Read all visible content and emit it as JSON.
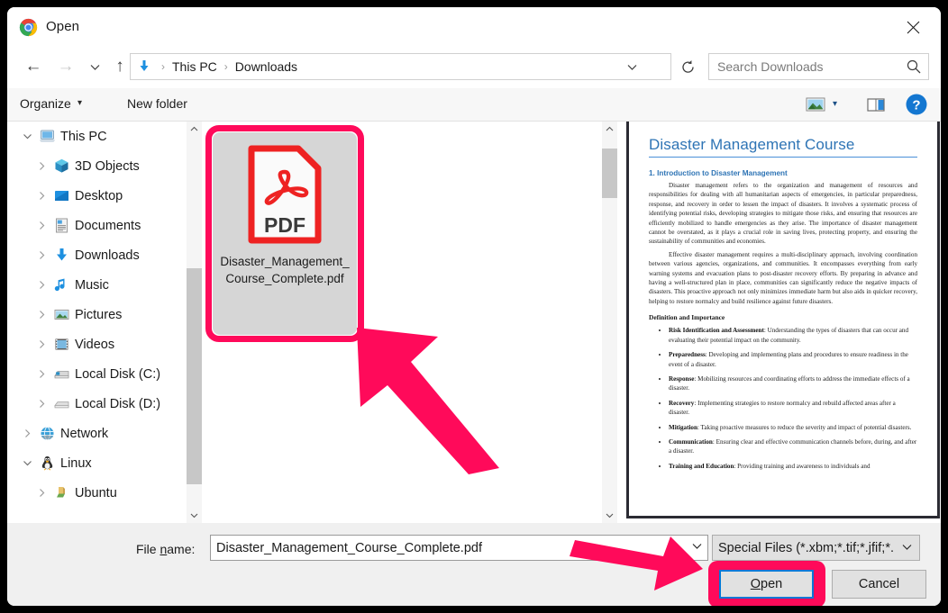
{
  "window": {
    "title": "Open",
    "app_icon": "chrome-logo-icon",
    "close_label": "×"
  },
  "nav": {
    "back_icon": "←",
    "forward_icon": "→",
    "recent_icon": "⌄",
    "up_icon": "↑",
    "address_icon": "downloads-arrow-icon",
    "breadcrumbs": [
      "This PC",
      "Downloads"
    ],
    "breadcrumb_separator": "›",
    "dropdown_icon": "⌄",
    "refresh_icon": "↻"
  },
  "search": {
    "placeholder": "Search Downloads",
    "icon": "search-icon"
  },
  "command_bar": {
    "organize_label": "Organize",
    "organize_caret": "▾",
    "new_folder_label": "New folder",
    "view_icon": "picture-view-icon",
    "view_caret": "▾",
    "pane_icon": "preview-pane-icon",
    "help_icon": "?"
  },
  "sidebar": {
    "items": [
      {
        "label": "This PC",
        "icon": "this-pc-icon",
        "depth": 0,
        "expander": "⌄",
        "expanded": true
      },
      {
        "label": "3D Objects",
        "icon": "3d-objects-icon",
        "depth": 1,
        "expander": "›",
        "expanded": false
      },
      {
        "label": "Desktop",
        "icon": "desktop-icon",
        "depth": 1,
        "expander": "›",
        "expanded": false
      },
      {
        "label": "Documents",
        "icon": "documents-icon",
        "depth": 1,
        "expander": "›",
        "expanded": false
      },
      {
        "label": "Downloads",
        "icon": "downloads-icon",
        "depth": 1,
        "expander": "›",
        "expanded": false
      },
      {
        "label": "Music",
        "icon": "music-icon",
        "depth": 1,
        "expander": "›",
        "expanded": false
      },
      {
        "label": "Pictures",
        "icon": "pictures-icon",
        "depth": 1,
        "expander": "›",
        "expanded": false
      },
      {
        "label": "Videos",
        "icon": "videos-icon",
        "depth": 1,
        "expander": "›",
        "expanded": false
      },
      {
        "label": "Local Disk (C:)",
        "icon": "hard-disk-icon",
        "depth": 1,
        "expander": "›",
        "expanded": false
      },
      {
        "label": "Local Disk (D:)",
        "icon": "hard-disk-icon",
        "depth": 1,
        "expander": "›",
        "expanded": false
      },
      {
        "label": "Network",
        "icon": "network-icon",
        "depth": 0,
        "expander": "›",
        "expanded": false
      },
      {
        "label": "Linux",
        "icon": "linux-penguin-icon",
        "depth": 0,
        "expander": "⌄",
        "expanded": true
      },
      {
        "label": "Ubuntu",
        "icon": "ubuntu-icon",
        "depth": 1,
        "expander": "›",
        "expanded": false
      }
    ],
    "scroll_up_icon": "⌃",
    "scroll_down_icon": "⌄"
  },
  "file_list": {
    "files": [
      {
        "name": "Disaster_Management_Course_Complete.pdf",
        "icon": "pdf-file-icon",
        "icon_label": "PDF",
        "selected": true
      }
    ],
    "scroll_up_icon": "⌃",
    "scroll_down_icon": "⌄"
  },
  "preview": {
    "doc_title": "Disaster Management Course",
    "heading_1": "1. Introduction to Disaster Management",
    "paragraph_1": "Disaster management refers to the organization and management of resources and responsibilities for dealing with all humanitarian aspects of emergencies, in particular preparedness, response, and recovery in order to lessen the impact of disasters. It involves a systematic process of identifying potential risks, developing strategies to mitigate those risks, and ensuring that resources are efficiently mobilized to handle emergencies as they arise. The importance of disaster management cannot be overstated, as it plays a crucial role in saving lives, protecting property, and ensuring the sustainability of communities and economies.",
    "paragraph_2": "Effective disaster management requires a multi-disciplinary approach, involving coordination between various agencies, organizations, and communities. It encompasses everything from early warning systems and evacuation plans to post-disaster recovery efforts. By preparing in advance and having a well-structured plan in place, communities can significantly reduce the negative impacts of disasters. This proactive approach not only minimizes immediate harm but also aids in quicker recovery, helping to restore normalcy and build resilience against future disasters.",
    "heading_2": "Definition and Importance",
    "bullets": [
      {
        "term": "Risk Identification and Assessment",
        "text": ": Understanding the types of disasters that can occur and evaluating their potential impact on the community."
      },
      {
        "term": "Preparedness",
        "text": ": Developing and implementing plans and procedures to ensure readiness in the event of a disaster."
      },
      {
        "term": "Response",
        "text": ": Mobilizing resources and coordinating efforts to address the immediate effects of a disaster."
      },
      {
        "term": "Recovery",
        "text": ": Implementing strategies to restore normalcy and rebuild affected areas after a disaster."
      },
      {
        "term": "Mitigation",
        "text": ": Taking proactive measures to reduce the severity and impact of potential disasters."
      },
      {
        "term": "Communication",
        "text": ": Ensuring clear and effective communication channels before, during, and after a disaster."
      },
      {
        "term": "Training and Education",
        "text": ": Providing training and awareness to individuals and"
      }
    ]
  },
  "footer": {
    "file_name_label_pre": "File ",
    "file_name_label_underline": "n",
    "file_name_label_post": "ame:",
    "file_name_value": "Disaster_Management_Course_Complete.pdf",
    "file_name_caret": "⌄",
    "filter_value": "Special Files (*.xbm;*.tif;*.jfif;*.",
    "filter_caret": "⌄",
    "open_label_pre": "",
    "open_label_underline": "O",
    "open_label_post": "pen",
    "cancel_label": "Cancel"
  },
  "annotations": {
    "arrow_color": "#ff0a5a",
    "selection_ring_color": "#ff0a5a",
    "focus_border_color": "#0078d7",
    "arrows": [
      {
        "name": "arrow-pointing-to-selected-file",
        "direction": "up-left"
      },
      {
        "name": "arrow-pointing-to-open-button",
        "direction": "right"
      }
    ]
  }
}
